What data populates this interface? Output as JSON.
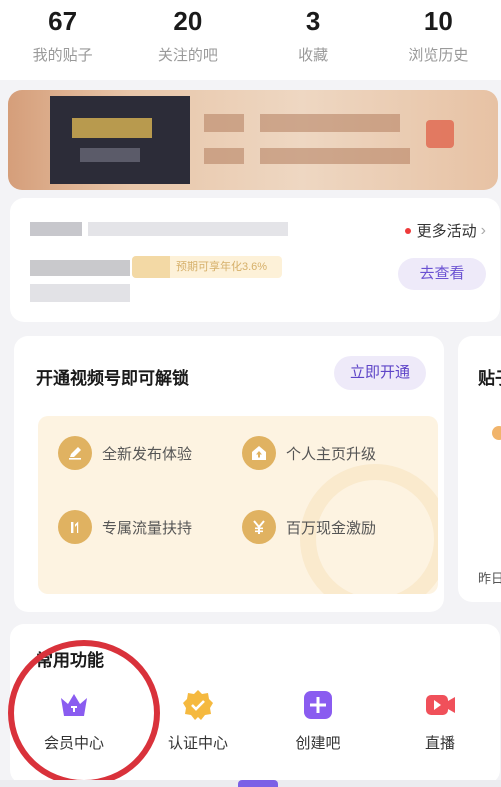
{
  "stats": [
    {
      "value": "67",
      "label": "我的贴子"
    },
    {
      "value": "20",
      "label": "关注的吧"
    },
    {
      "value": "3",
      "label": "收藏"
    },
    {
      "value": "10",
      "label": "浏览历史"
    }
  ],
  "activity": {
    "more_label": "更多活动",
    "go_label": "去查看",
    "tag_text": "预期可享年化3.6%"
  },
  "unlock": {
    "title": "开通视频号即可解锁",
    "open_label": "立即开通",
    "benefits": [
      {
        "label": "全新发布体验",
        "icon": "pen-icon"
      },
      {
        "label": "个人主页升级",
        "icon": "home-up-icon"
      },
      {
        "label": "专属流量扶持",
        "icon": "traffic-icon"
      },
      {
        "label": "百万现金激励",
        "icon": "yuan-icon"
      }
    ]
  },
  "side_card": {
    "title": "贴子",
    "bottom": "昨日"
  },
  "functions": {
    "title": "常用功能",
    "items": [
      {
        "label": "会员中心",
        "icon": "crown-icon",
        "color": "#8a5cf0"
      },
      {
        "label": "认证中心",
        "icon": "verified-badge-icon",
        "color": "#f5b93f"
      },
      {
        "label": "创建吧",
        "icon": "plus-square-icon",
        "color": "#8a5cf0"
      },
      {
        "label": "直播",
        "icon": "video-camera-icon",
        "color": "#f0505a"
      }
    ]
  },
  "colors": {
    "accent": "#6a51d2",
    "highlight": "#d9323b",
    "benefit_bg": "#fdf3e1"
  }
}
